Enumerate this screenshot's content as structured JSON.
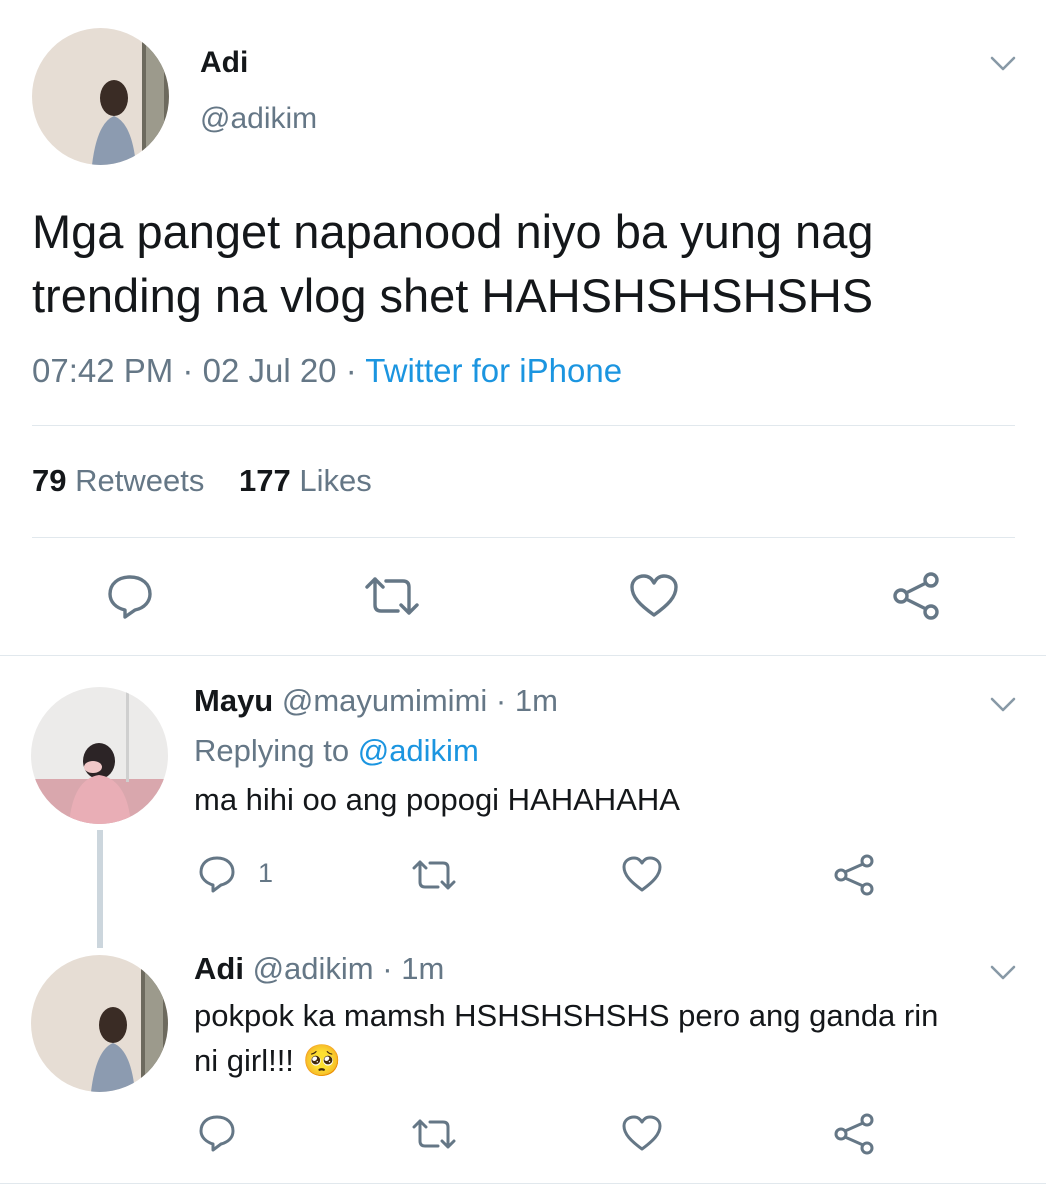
{
  "main_tweet": {
    "author_name": "Adi",
    "author_handle": "@adikim",
    "text_line1": "Mga panget napanood niyo ba yung nag",
    "text_line2": "trending na vlog shet HAHSHSHSHSHS",
    "time": "07:42 PM",
    "sep1": "·",
    "date": "02 Jul 20",
    "sep2": "·",
    "source": "Twitter for iPhone",
    "retweet_count": "79",
    "retweet_label": "Retweets",
    "like_count": "177",
    "like_label": "Likes",
    "icons": [
      "reply-icon",
      "retweet-icon",
      "like-icon",
      "share-icon",
      "chevron-down-icon"
    ]
  },
  "replies": [
    {
      "author_name": "Mayu",
      "author_handle": "@mayumimimi",
      "dot": "·",
      "time": "1m",
      "replying_prefix": "Replying to",
      "replying_handle": "@adikim",
      "text": "ma hihi oo ang popogi HAHAHAHA",
      "reply_count": "1"
    },
    {
      "author_name": "Adi",
      "author_handle": "@adikim",
      "dot": "·",
      "time": "1m",
      "text_line1": "pokpok ka mamsh HSHSHSHSHS pero ang ganda rin",
      "text_line2": "ni girl!!! 🥺"
    }
  ],
  "colors": {
    "text": "#14171a",
    "secondary": "#657786",
    "link": "#1b95e0",
    "divider": "#e1e8ed",
    "thread_line": "#ccd6dd"
  }
}
